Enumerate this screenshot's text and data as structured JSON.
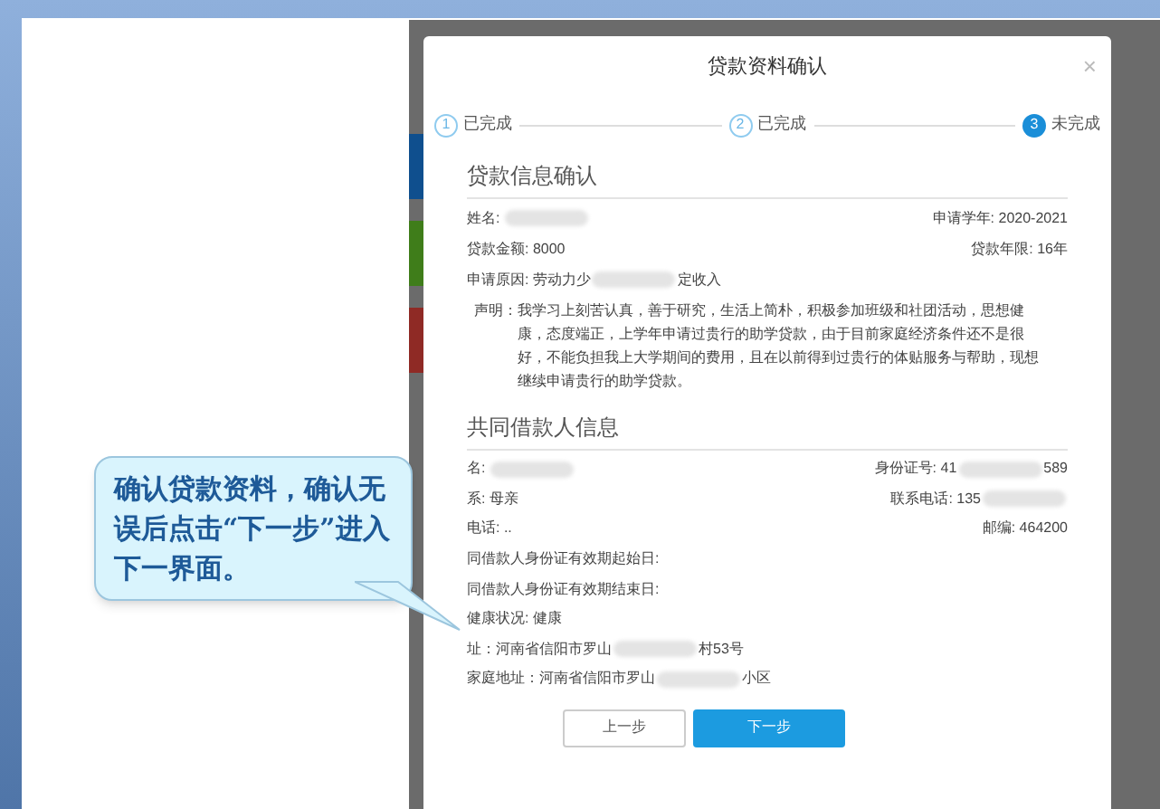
{
  "dialog": {
    "title": "贷款资料确认",
    "close": "×"
  },
  "steps": [
    {
      "number": "1",
      "label": "已完成",
      "selected": false
    },
    {
      "number": "2",
      "label": "已完成",
      "selected": false
    },
    {
      "number": "3",
      "label": "未完成",
      "selected": true
    }
  ],
  "loan_info": {
    "heading": "贷款信息确认",
    "rows": [
      {
        "left": [
          {
            "kind": "text",
            "text": "姓名: "
          },
          {
            "kind": "blur"
          }
        ],
        "right": [
          {
            "kind": "text",
            "text": "申请学年: 2020-2021"
          }
        ]
      },
      {
        "left": [
          {
            "kind": "text",
            "text": "贷款金额: 8000"
          }
        ],
        "right": [
          {
            "kind": "text",
            "text": "贷款年限: 16年"
          }
        ]
      },
      {
        "left": [
          {
            "kind": "text",
            "text": "申请原因: 劳动力少"
          },
          {
            "kind": "blur"
          },
          {
            "kind": "text",
            "text": "定收入"
          }
        ],
        "right": []
      }
    ],
    "statement": {
      "label": "声明：",
      "text": "我学习上刻苦认真，善于研究，生活上简朴，积极参加班级和社团活动，思想健康，态度端正，上学年申请过贵行的助学贷款，由于目前家庭经济条件还不是很好，不能负担我上大学期间的费用，且在以前得到过贵行的体贴服务与帮助，现想继续申请贵行的助学贷款。"
    }
  },
  "co_borrower": {
    "heading": "共同借款人信息",
    "rows": [
      {
        "left": [
          {
            "kind": "text",
            "text": "名: "
          },
          {
            "kind": "blur"
          }
        ],
        "right": [
          {
            "kind": "text",
            "text": "身份证号: 41"
          },
          {
            "kind": "blur"
          },
          {
            "kind": "text",
            "text": "589"
          }
        ]
      },
      {
        "left": [
          {
            "kind": "text",
            "text": "系: 母亲"
          }
        ],
        "right": [
          {
            "kind": "text",
            "text": "联系电话: 135"
          },
          {
            "kind": "blur"
          }
        ]
      },
      {
        "left": [
          {
            "kind": "text",
            "text": "电话: .."
          }
        ],
        "right": [
          {
            "kind": "text",
            "text": "邮编: 464200"
          }
        ]
      },
      {
        "left": [
          {
            "kind": "text",
            "text": "同借款人身份证有效期起始日:"
          }
        ],
        "right": []
      },
      {
        "left": [
          {
            "kind": "text",
            "text": "同借款人身份证有效期结束日:"
          }
        ],
        "right": []
      },
      {
        "left": [
          {
            "kind": "text",
            "text": "健康状况: 健康"
          }
        ],
        "right": []
      },
      {
        "left": [
          {
            "kind": "text",
            "text": "址：河南省信阳市罗山"
          },
          {
            "kind": "blur"
          },
          {
            "kind": "text",
            "text": "村53号"
          }
        ],
        "right": []
      },
      {
        "left": [
          {
            "kind": "text",
            "text": "家庭地址：河南省信阳市罗山"
          },
          {
            "kind": "blur"
          },
          {
            "kind": "text",
            "text": "小区"
          }
        ],
        "right": []
      }
    ]
  },
  "buttons": [
    {
      "label": "上一步",
      "kind": "secondary"
    },
    {
      "label": "下一步",
      "kind": "primary"
    }
  ],
  "callout": {
    "text": "确认贷款资料，确认无误后点击“下一步”进入下一界面。"
  }
}
